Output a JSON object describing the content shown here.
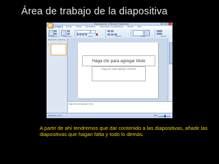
{
  "slide": {
    "title": "Área de trabajo de la diapositiva",
    "caption": "A partir de ahí tendremos que dar contenido a las diapositivas, añadir las diapositivas que hagan falta y todo lo demás.",
    "colors": {
      "background": "#000000",
      "title": "#e8e8e8",
      "caption": "#f0d000"
    }
  },
  "app": {
    "window_title": "Presentación1 - Microsoft PowerPoint",
    "tabs": [
      "Inicio",
      "Insertar",
      "Diseño",
      "Animaciones",
      "Presentación con diapositivas",
      "Revisar",
      "Vista"
    ],
    "active_tab": "Inicio",
    "ribbon_groups": [
      "Portapapeles",
      "Diapositivas",
      "Fuente",
      "Párrafo",
      "Dibujo",
      "Edición"
    ],
    "outline_tabs": [
      "Diapositivas",
      "Esquema"
    ],
    "slide_number": "1",
    "title_placeholder": "Haga clic para agregar título",
    "subtitle_placeholder": "Haga clic para agregar subtítulo",
    "notes_placeholder": "Haga clic para agregar notas",
    "status": "Diapositiva 1 de 1",
    "zoom": "63%"
  }
}
